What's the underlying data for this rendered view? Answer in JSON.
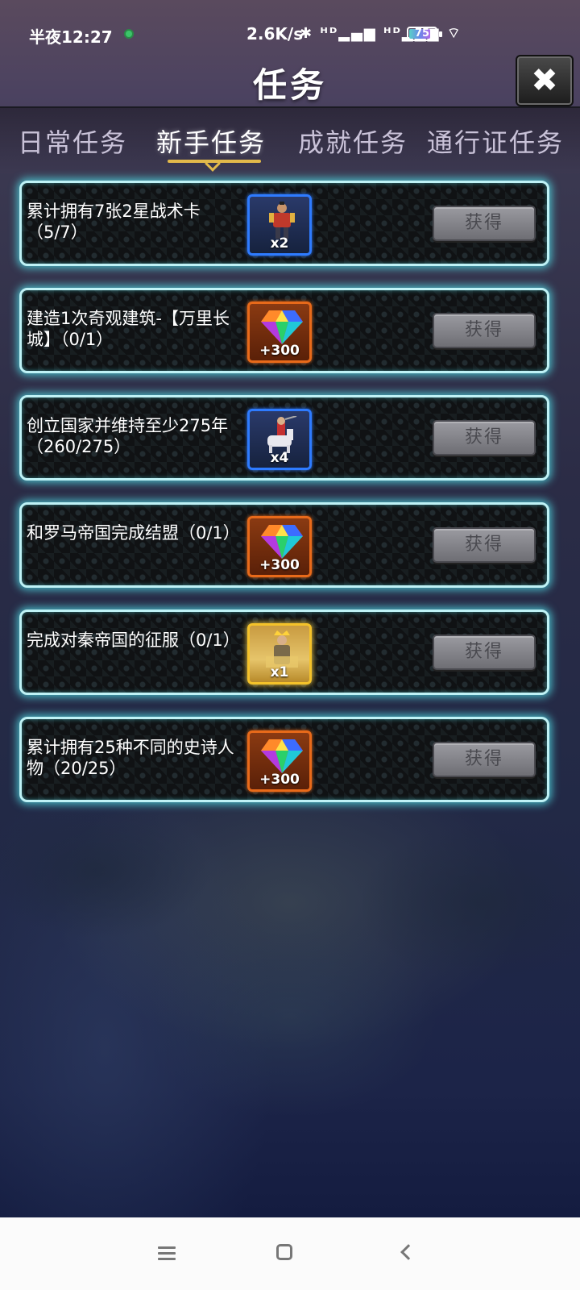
{
  "status_bar": {
    "time": "半夜12:27",
    "net_speed": "2.6K/s",
    "signal_icons": "✱ ᴴᴰ▂▄▆ ᴴᴰ▂▄▆ ⌔",
    "battery": "75"
  },
  "header": {
    "title": "任务",
    "close_icon": "✖"
  },
  "tabs": [
    {
      "label": "日常任务",
      "active": false
    },
    {
      "label": "新手任务",
      "active": true
    },
    {
      "label": "成就任务",
      "active": false
    },
    {
      "label": "通行证任务",
      "active": false
    }
  ],
  "quests": [
    {
      "text": "累计拥有7张2星战术卡（5/7）",
      "reward_type": "card-soldier",
      "reward_frame": "blue",
      "reward_qty": "x2",
      "button": "获得"
    },
    {
      "text": "建造1次奇观建筑-【万里长城】（0/1）",
      "reward_type": "gem",
      "reward_frame": "orange",
      "reward_qty": "+300",
      "button": "获得"
    },
    {
      "text": "创立国家并维持至少275年（260/275）",
      "reward_type": "card-knight",
      "reward_frame": "blue",
      "reward_qty": "x4",
      "button": "获得"
    },
    {
      "text": "和罗马帝国完成结盟（0/1）",
      "reward_type": "gem",
      "reward_frame": "orange",
      "reward_qty": "+300",
      "button": "获得"
    },
    {
      "text": "完成对秦帝国的征服（0/1）",
      "reward_type": "card-emperor",
      "reward_frame": "gold",
      "reward_qty": "x1",
      "button": "获得"
    },
    {
      "text": "累计拥有25种不同的史诗人物（20/25）",
      "reward_type": "gem",
      "reward_frame": "orange",
      "reward_qty": "+300",
      "button": "获得"
    }
  ],
  "nav": {
    "menu_icon": "menu-icon",
    "home_icon": "home-icon",
    "back_icon": "back-icon"
  }
}
